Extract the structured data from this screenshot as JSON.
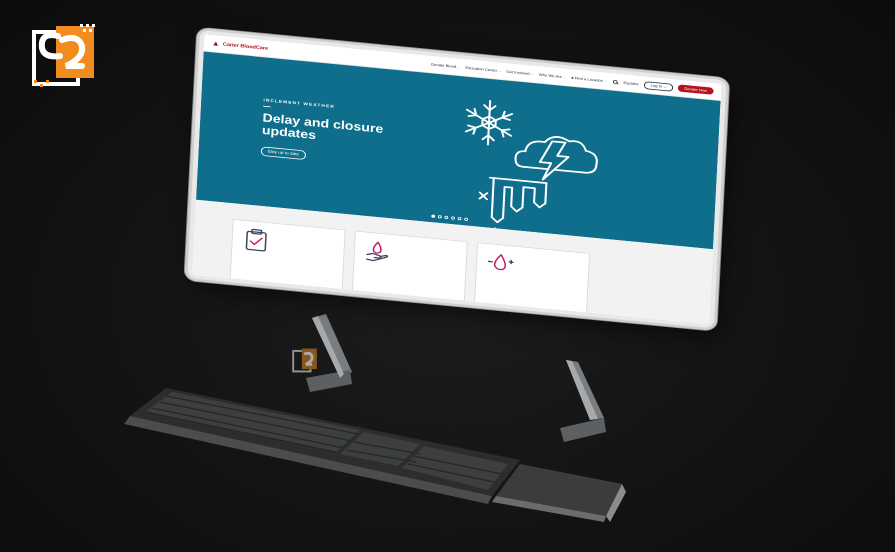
{
  "site": {
    "logo_text": "Carter BloodCare",
    "nav": [
      {
        "label": "Donate Blood"
      },
      {
        "label": "Education Center"
      },
      {
        "label": "Get Involved"
      },
      {
        "label": "Who We Are"
      },
      {
        "label": "Find a Location"
      }
    ],
    "lang": "Español",
    "login_label": "Log In",
    "donate_label": "Donate Now"
  },
  "hero": {
    "eyebrow": "INCLEMENT WEATHER",
    "headline": "Delay and closure updates",
    "cta": "Stay up to date",
    "slides": 6,
    "active_slide": 1
  },
  "colors": {
    "brand_red": "#b5121b",
    "hero_teal": "#0f6e8c",
    "brand_orange": "#f28c1e"
  },
  "icons": {
    "hero": [
      "snowflake-icon",
      "storm-cloud-icon",
      "icicle-icon"
    ],
    "cards": [
      "clipboard-check-icon",
      "hand-blood-drop-icon",
      "blood-drop-plus-minus-icon"
    ]
  }
}
